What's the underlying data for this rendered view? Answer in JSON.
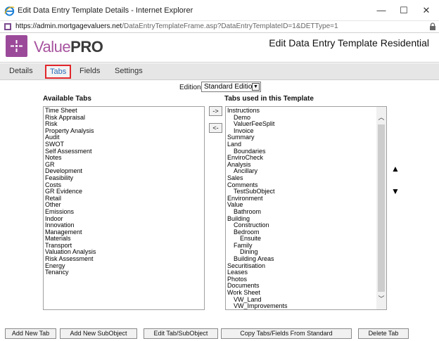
{
  "window": {
    "title": "Edit Data Entry Template Details - Internet Explorer",
    "url_host": "https://admin.mortgagevaluers.net",
    "url_path": "/DataEntryTemplateFrame.asp?DataEntryTemplateID=1&DETType=1",
    "minimize": "—",
    "maximize": "☐",
    "close": "✕"
  },
  "header": {
    "logo_value": "Value",
    "logo_pro": "PRO",
    "page_title": "Edit Data Entry Template Residential"
  },
  "tabs": [
    {
      "label": "Details"
    },
    {
      "label": "Tabs"
    },
    {
      "label": "Fields"
    },
    {
      "label": "Settings"
    }
  ],
  "edition": {
    "label": "Edition:",
    "selected": "Standard Edition"
  },
  "available": {
    "heading": "Available Tabs",
    "items": [
      "Time Sheet",
      "Risk Appraisal",
      "Risk",
      "Property Analysis",
      "Audit",
      "SWOT",
      "Self Assessment",
      "Notes",
      "GR",
      "Development",
      "Feasibility",
      "Costs",
      "GR Evidence",
      "Retail",
      "Other",
      "Emissions",
      "Indoor",
      "Innovation",
      "Management",
      "Materials",
      "Transport",
      "Valuation Analysis",
      "Risk Assessment",
      "Energy",
      "Tenancy"
    ]
  },
  "used": {
    "heading": "Tabs used in this Template",
    "items": [
      {
        "label": "Instructions",
        "level": 0
      },
      {
        "label": "Demo",
        "level": 1
      },
      {
        "label": "ValuerFeeSplit",
        "level": 1
      },
      {
        "label": "Invoice",
        "level": 1
      },
      {
        "label": "Summary",
        "level": 0
      },
      {
        "label": "Land",
        "level": 0
      },
      {
        "label": "Boundaries",
        "level": 1
      },
      {
        "label": "EnviroCheck",
        "level": 0
      },
      {
        "label": "Analysis",
        "level": 0
      },
      {
        "label": "Ancillary",
        "level": 1
      },
      {
        "label": "Sales",
        "level": 0
      },
      {
        "label": "Comments",
        "level": 0
      },
      {
        "label": "TestSubObject",
        "level": 1
      },
      {
        "label": "Environment",
        "level": 0
      },
      {
        "label": "Value",
        "level": 0
      },
      {
        "label": "Bathroom",
        "level": 1
      },
      {
        "label": "Building",
        "level": 0
      },
      {
        "label": "Construction",
        "level": 1
      },
      {
        "label": "Bedroom",
        "level": 1
      },
      {
        "label": "Ensuite",
        "level": 2
      },
      {
        "label": "Family",
        "level": 1
      },
      {
        "label": "Dining",
        "level": 2
      },
      {
        "label": "Building Areas",
        "level": 1
      },
      {
        "label": "Securitisation",
        "level": 0
      },
      {
        "label": "Leases",
        "level": 0
      },
      {
        "label": "Photos",
        "level": 0
      },
      {
        "label": "Documents",
        "level": 0
      },
      {
        "label": "Work Sheet",
        "level": 0
      },
      {
        "label": "VW_Land",
        "level": 1
      },
      {
        "label": "VW_Improvements",
        "level": 1
      }
    ]
  },
  "move": {
    "add": "->",
    "remove": "<-"
  },
  "order": {
    "up": "▲",
    "down": "▼"
  },
  "buttons": {
    "add_tab": "Add New Tab",
    "add_subobject": "Add New SubObject",
    "edit": "Edit Tab/SubObject",
    "copy": "Copy Tabs/Fields From Standard",
    "delete": "Delete Tab"
  },
  "colors": {
    "brand": "#9b4a9a",
    "active_tab_outline": "#e2272b",
    "active_tab_text": "#2a6bb8"
  }
}
